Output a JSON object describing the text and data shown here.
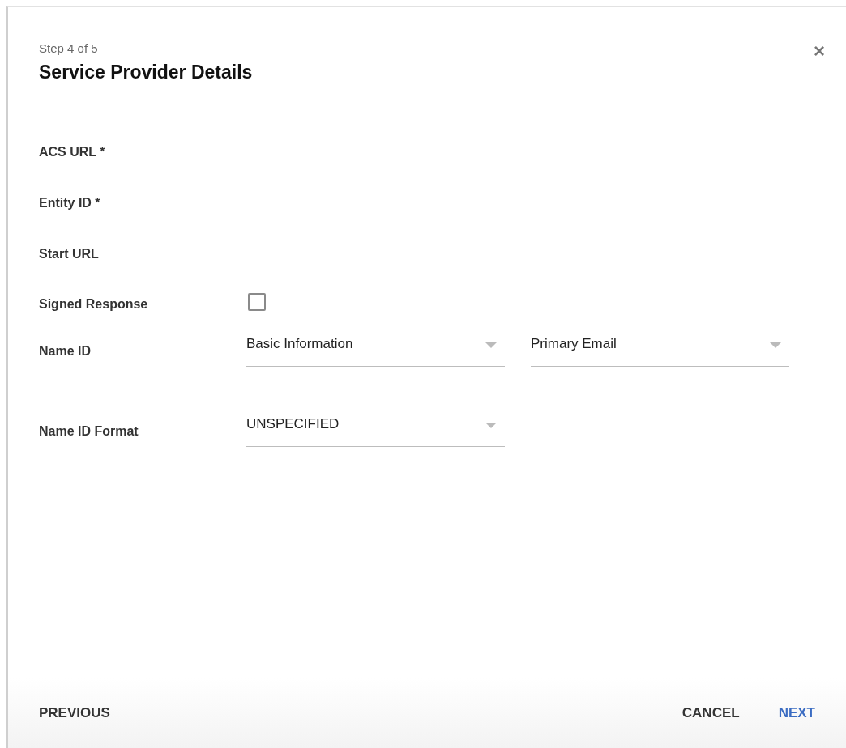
{
  "dialog": {
    "step": "Step 4 of 5",
    "title": "Service Provider Details",
    "close": "×"
  },
  "fields": [
    {
      "kind": "text",
      "label": "ACS URL *"
    },
    {
      "kind": "text",
      "label": "Entity ID *"
    },
    {
      "kind": "text",
      "label": "Start URL"
    },
    {
      "kind": "checkbox",
      "label": "Signed Response",
      "checked": false
    },
    {
      "kind": "select",
      "label": "Name ID",
      "selects": [
        "Basic Information",
        "Primary Email"
      ]
    },
    {
      "kind": "select",
      "label": "Name ID Format",
      "selects": [
        "UNSPECIFIED"
      ]
    }
  ],
  "footer": {
    "previous": "PREVIOUS",
    "cancel": "CANCEL",
    "next": "NEXT"
  }
}
